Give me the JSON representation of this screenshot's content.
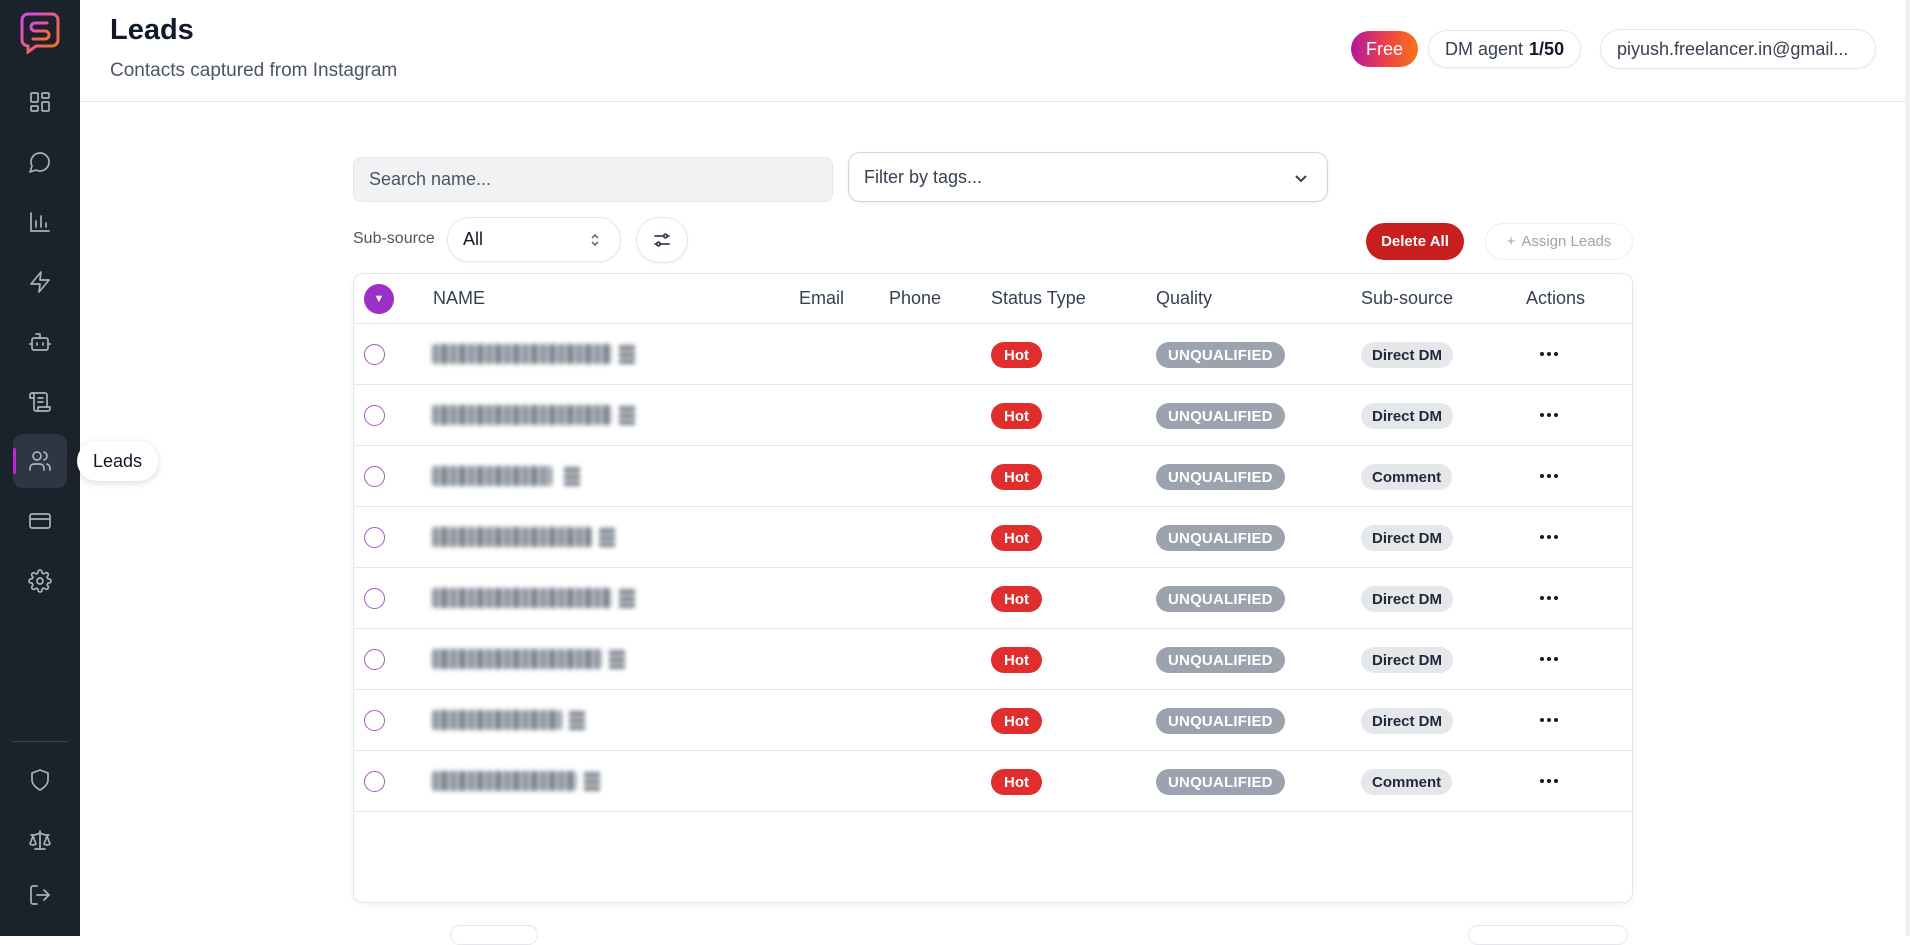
{
  "sidebar": {
    "tooltip": "Leads",
    "items": [
      {
        "icon": "dashboard-icon"
      },
      {
        "icon": "chat-icon"
      },
      {
        "icon": "analytics-icon"
      },
      {
        "icon": "lightning-icon"
      },
      {
        "icon": "bot-icon"
      },
      {
        "icon": "scroll-icon"
      },
      {
        "icon": "users-icon",
        "active": true
      },
      {
        "icon": "credit-card-icon"
      },
      {
        "icon": "gear-icon"
      },
      {
        "icon": "shield-icon"
      },
      {
        "icon": "scale-icon"
      },
      {
        "icon": "logout-icon"
      }
    ]
  },
  "header": {
    "title": "Leads",
    "subtitle": "Contacts captured from Instagram",
    "plan_badge": "Free",
    "agent_label": "DM agent",
    "agent_count": "1/50",
    "user_email": "piyush.freelancer.in@gmail..."
  },
  "toolbar": {
    "search_placeholder": "Search name...",
    "tags_placeholder": "Filter by tags...",
    "subsource_label": "Sub-source",
    "subsource_value": "All",
    "delete_all_label": "Delete All",
    "assign_leads_label": "Assign Leads"
  },
  "table": {
    "columns": [
      "NAME",
      "Email",
      "Phone",
      "Status Type",
      "Quality",
      "Sub-source",
      "Actions"
    ],
    "rows": [
      {
        "status": "Hot",
        "quality": "UNQUALIFIED",
        "subsource": "Direct DM"
      },
      {
        "status": "Hot",
        "quality": "UNQUALIFIED",
        "subsource": "Direct DM"
      },
      {
        "status": "Hot",
        "quality": "UNQUALIFIED",
        "subsource": "Comment"
      },
      {
        "status": "Hot",
        "quality": "UNQUALIFIED",
        "subsource": "Direct DM"
      },
      {
        "status": "Hot",
        "quality": "UNQUALIFIED",
        "subsource": "Direct DM"
      },
      {
        "status": "Hot",
        "quality": "UNQUALIFIED",
        "subsource": "Direct DM"
      },
      {
        "status": "Hot",
        "quality": "UNQUALIFIED",
        "subsource": "Direct DM"
      },
      {
        "status": "Hot",
        "quality": "UNQUALIFIED",
        "subsource": "Comment"
      }
    ]
  },
  "colors": {
    "sidebar_bg": "#1c222c",
    "accent": "#9b30c9",
    "danger": "#c81e1e",
    "hot": "#e02d2d",
    "qualified_gray": "#9ca3af"
  }
}
